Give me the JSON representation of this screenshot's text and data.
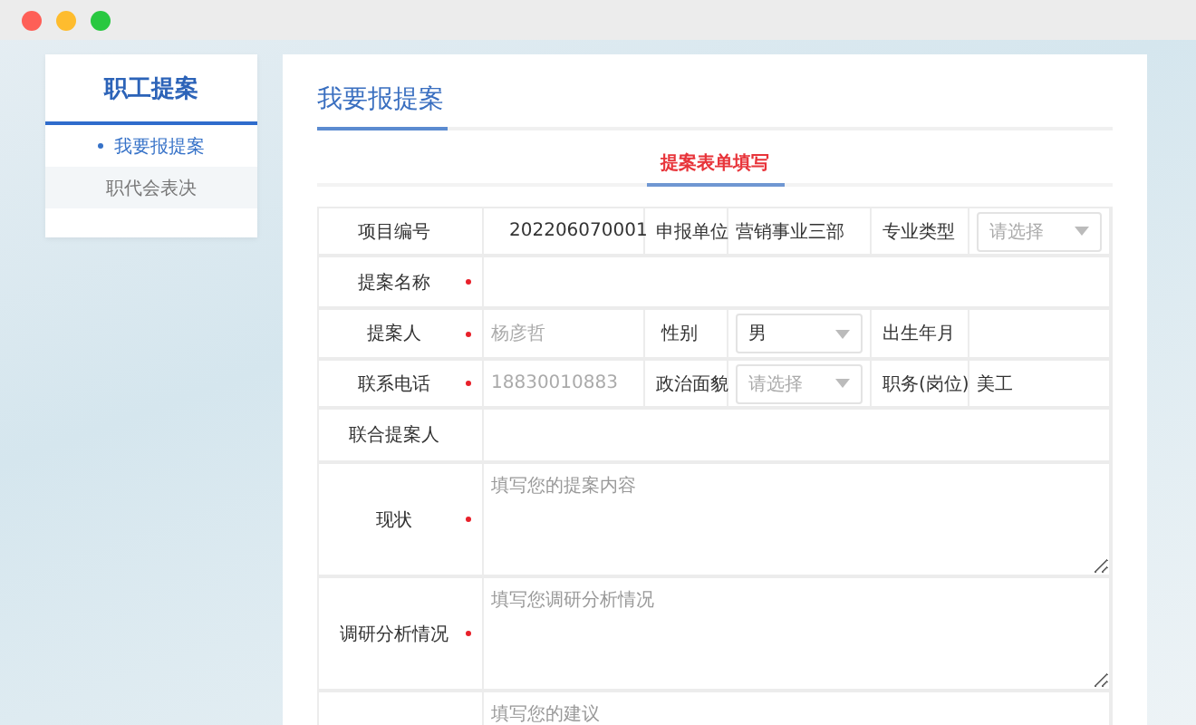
{
  "sidebar": {
    "title": "职工提案",
    "items": [
      {
        "label": "我要报提案",
        "selected": true
      },
      {
        "label": "职代会表决",
        "selected": false
      }
    ]
  },
  "main": {
    "title": "我要报提案",
    "tabs": [
      {
        "label": "提案表单填写",
        "selected": true
      }
    ]
  },
  "form_rows": [
    {
      "cells": [
        {
          "kind": "label",
          "text": "项目编号",
          "required": false
        },
        {
          "kind": "text",
          "value": "202206070001",
          "disabled": false
        },
        {
          "kind": "label",
          "text": "申报单位",
          "required": false
        },
        {
          "kind": "text",
          "value": "营销事业三部",
          "disabled": false
        },
        {
          "kind": "label",
          "text": "专业类型",
          "required": false
        },
        {
          "kind": "select",
          "placeholder": "请选择"
        }
      ]
    },
    {
      "cells": [
        {
          "kind": "label",
          "text": "提案名称",
          "required": true
        },
        {
          "kind": "input"
        }
      ]
    },
    {
      "cells": [
        {
          "kind": "label",
          "text": "提案人",
          "required": true
        },
        {
          "kind": "text",
          "value": "杨彦哲",
          "disabled": true
        },
        {
          "kind": "label",
          "text": "性别",
          "required": false
        },
        {
          "kind": "select",
          "value": "男"
        },
        {
          "kind": "label",
          "text": "出生年月",
          "required": false
        },
        {
          "kind": "input"
        }
      ]
    },
    {
      "cells": [
        {
          "kind": "label",
          "text": "联系电话",
          "required": true
        },
        {
          "kind": "text",
          "value": "18830010883",
          "disabled": true
        },
        {
          "kind": "label",
          "text": "政治面貌",
          "required": false
        },
        {
          "kind": "select",
          "placeholder": "请选择"
        },
        {
          "kind": "label",
          "text": "职务(岗位)",
          "required": false
        },
        {
          "kind": "text",
          "value": "美工",
          "disabled": false
        }
      ]
    },
    {
      "cells": [
        {
          "kind": "label",
          "text": "联合提案人",
          "required": false
        },
        {
          "kind": "input"
        }
      ]
    },
    {
      "cells": [
        {
          "kind": "label",
          "text": "现状",
          "required": true
        },
        {
          "kind": "textarea",
          "placeholder": "填写您的提案内容"
        }
      ]
    },
    {
      "cells": [
        {
          "kind": "label",
          "text": "调研分析情况",
          "required": true
        },
        {
          "kind": "textarea",
          "placeholder": "填写您调研分析情况"
        }
      ]
    },
    {
      "cells": [
        {
          "kind": "label"
        },
        {
          "kind": "textarea",
          "placeholder": "填写您的建议"
        }
      ]
    }
  ]
}
